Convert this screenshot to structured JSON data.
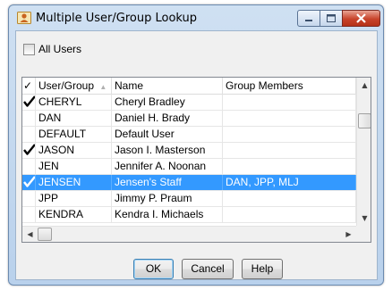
{
  "window": {
    "title": "Multiple User/Group Lookup"
  },
  "options": {
    "all_users_label": "All Users",
    "all_users_checked": false
  },
  "grid": {
    "columns": [
      {
        "label": "✓"
      },
      {
        "label": "User/Group",
        "sort_indicator": "▲"
      },
      {
        "label": "Name"
      },
      {
        "label": "Group Members"
      }
    ],
    "rows": [
      {
        "checked": true,
        "user": "CHERYL",
        "name": "Cheryl Bradley",
        "members": ""
      },
      {
        "checked": false,
        "user": "DAN",
        "name": "Daniel H. Brady",
        "members": ""
      },
      {
        "checked": false,
        "user": "DEFAULT",
        "name": "Default User",
        "members": ""
      },
      {
        "checked": true,
        "user": "JASON",
        "name": "Jason I. Masterson",
        "members": ""
      },
      {
        "checked": false,
        "user": "JEN",
        "name": "Jennifer A. Noonan",
        "members": ""
      },
      {
        "checked": true,
        "user": "JENSEN",
        "name": "Jensen's Staff",
        "members": "DAN, JPP, MLJ",
        "selected": true
      },
      {
        "checked": false,
        "user": "JPP",
        "name": "Jimmy P. Praum",
        "members": ""
      },
      {
        "checked": false,
        "user": "KENDRA",
        "name": "Kendra I. Michaels",
        "members": ""
      }
    ]
  },
  "buttons": {
    "ok": "OK",
    "cancel": "Cancel",
    "help": "Help"
  },
  "colors": {
    "selection": "#3399ff",
    "title_bar": "#b9d1ec",
    "close_button": "#c8432a"
  }
}
